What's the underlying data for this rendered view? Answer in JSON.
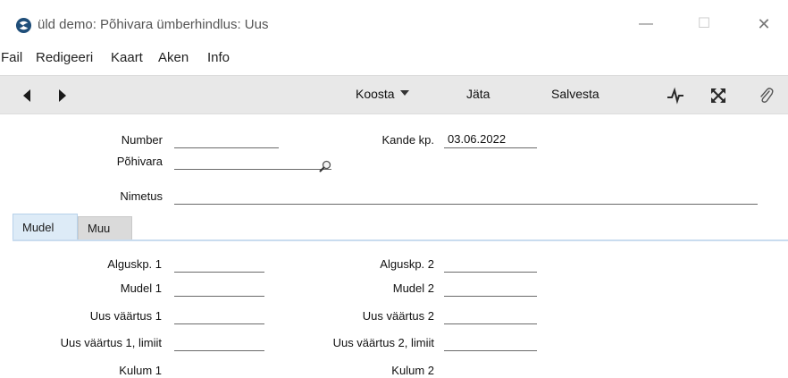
{
  "window": {
    "title": "üld demo: Põhivara ümberhindlus: Uus",
    "minimize_symbol": "—",
    "maximize_symbol": "☐",
    "close_symbol": "✕"
  },
  "menu": [
    "Fail",
    "Redigeeri",
    "Kaart",
    "Aken",
    "Info"
  ],
  "toolbar": {
    "koosta_label": "Koosta",
    "jata_label": "Jäta",
    "salvesta_label": "Salvesta",
    "icons": [
      "back-arrow-icon",
      "forward-arrow-icon",
      "pulse-icon",
      "expand-icon",
      "paperclip-icon"
    ]
  },
  "header_fields": {
    "number_label": "Number",
    "number_value": "",
    "kande_kp_label": "Kande kp.",
    "kande_kp_value": "03.06.2022",
    "pohivara_label": "Põhivara",
    "pohivara_value": "",
    "nimetus_label": "Nimetus",
    "nimetus_value": ""
  },
  "tabs": [
    {
      "label": "Mudel",
      "active": true
    },
    {
      "label": "Muu",
      "active": false
    }
  ],
  "mudel_fields": {
    "alguskp1_label": "Alguskp. 1",
    "alguskp2_label": "Alguskp. 2",
    "mudel1_label": "Mudel 1",
    "mudel2_label": "Mudel 2",
    "uus_vaartus1_label": "Uus väärtus 1",
    "uus_vaartus2_label": "Uus väärtus 2",
    "uus_vaartus1_limiit_label": "Uus väärtus 1, limiit",
    "uus_vaartus2_limiit_label": "Uus väärtus 2, limiit",
    "kulum1_label": "Kulum 1",
    "kulum2_label": "Kulum 2"
  },
  "colors": {
    "toolbar_bg": "#e8e8e8",
    "active_tab_bg": "#ddebf7",
    "inactive_tab_bg": "#dadada",
    "app_icon": "#1f4e79"
  }
}
